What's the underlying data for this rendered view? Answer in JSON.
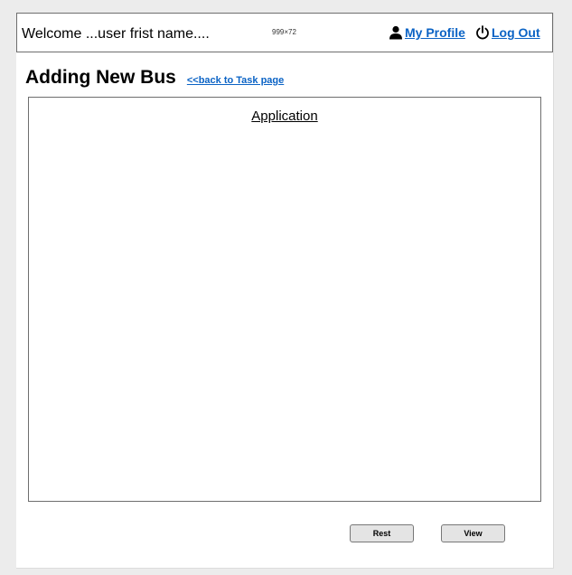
{
  "header": {
    "welcome_text": "Welcome ...user frist name....",
    "size_label": "999×72",
    "profile_label": "My Profile",
    "profile_icon": "user-icon",
    "logout_label": "Log Out",
    "logout_icon": "power-icon",
    "link_color": "#0b63c5"
  },
  "page": {
    "title": "Adding New Bus",
    "back_link": "<<back to Task page"
  },
  "panel": {
    "title": "Application"
  },
  "actions": {
    "rest_label": "Rest",
    "view_label": "View"
  }
}
